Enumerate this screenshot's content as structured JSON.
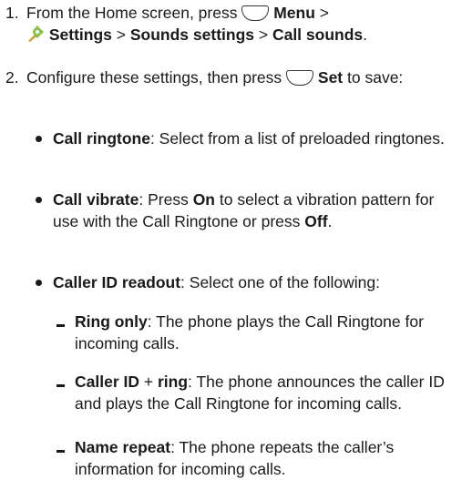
{
  "steps": [
    {
      "number": "1.",
      "line1_pre": "From the Home screen, press ",
      "line1_menu": "Menu",
      "line1_sep": " >",
      "line2_settings": "Settings",
      "line2_sep1": " > ",
      "line2_sounds": "Sounds settings",
      "line2_sep2": " > ",
      "line2_call": "Call sounds",
      "line2_end": "."
    },
    {
      "number": "2.",
      "pre": "Configure these settings, then press ",
      "set": "Set",
      "post": " to save:"
    }
  ],
  "bullets": [
    {
      "title": "Call ringtone",
      "text": ": Select from a list of preloaded ringtones."
    },
    {
      "title": "Call vibrate",
      "text1": ": Press ",
      "on": "On",
      "text2": " to select a vibration pattern for use with the Call Ringtone or press ",
      "off": "Off",
      "text3": "."
    },
    {
      "title": "Caller ID readout",
      "text": ": Select one of the following:"
    }
  ],
  "sub_items": [
    {
      "title": "Ring only",
      "text": ": The phone plays the Call Ringtone for incoming calls."
    },
    {
      "title_a": "Caller ID",
      "plus": " + ",
      "title_b": "ring",
      "text": ": The phone announces the caller ID and plays the Call Ringtone for incoming calls."
    },
    {
      "title": "Name repeat",
      "text": ": The phone repeats the caller’s information for incoming calls."
    }
  ],
  "icons": {
    "menu_key": "soft-key-icon",
    "settings": "settings-gear-icon",
    "set_key": "soft-key-icon"
  }
}
